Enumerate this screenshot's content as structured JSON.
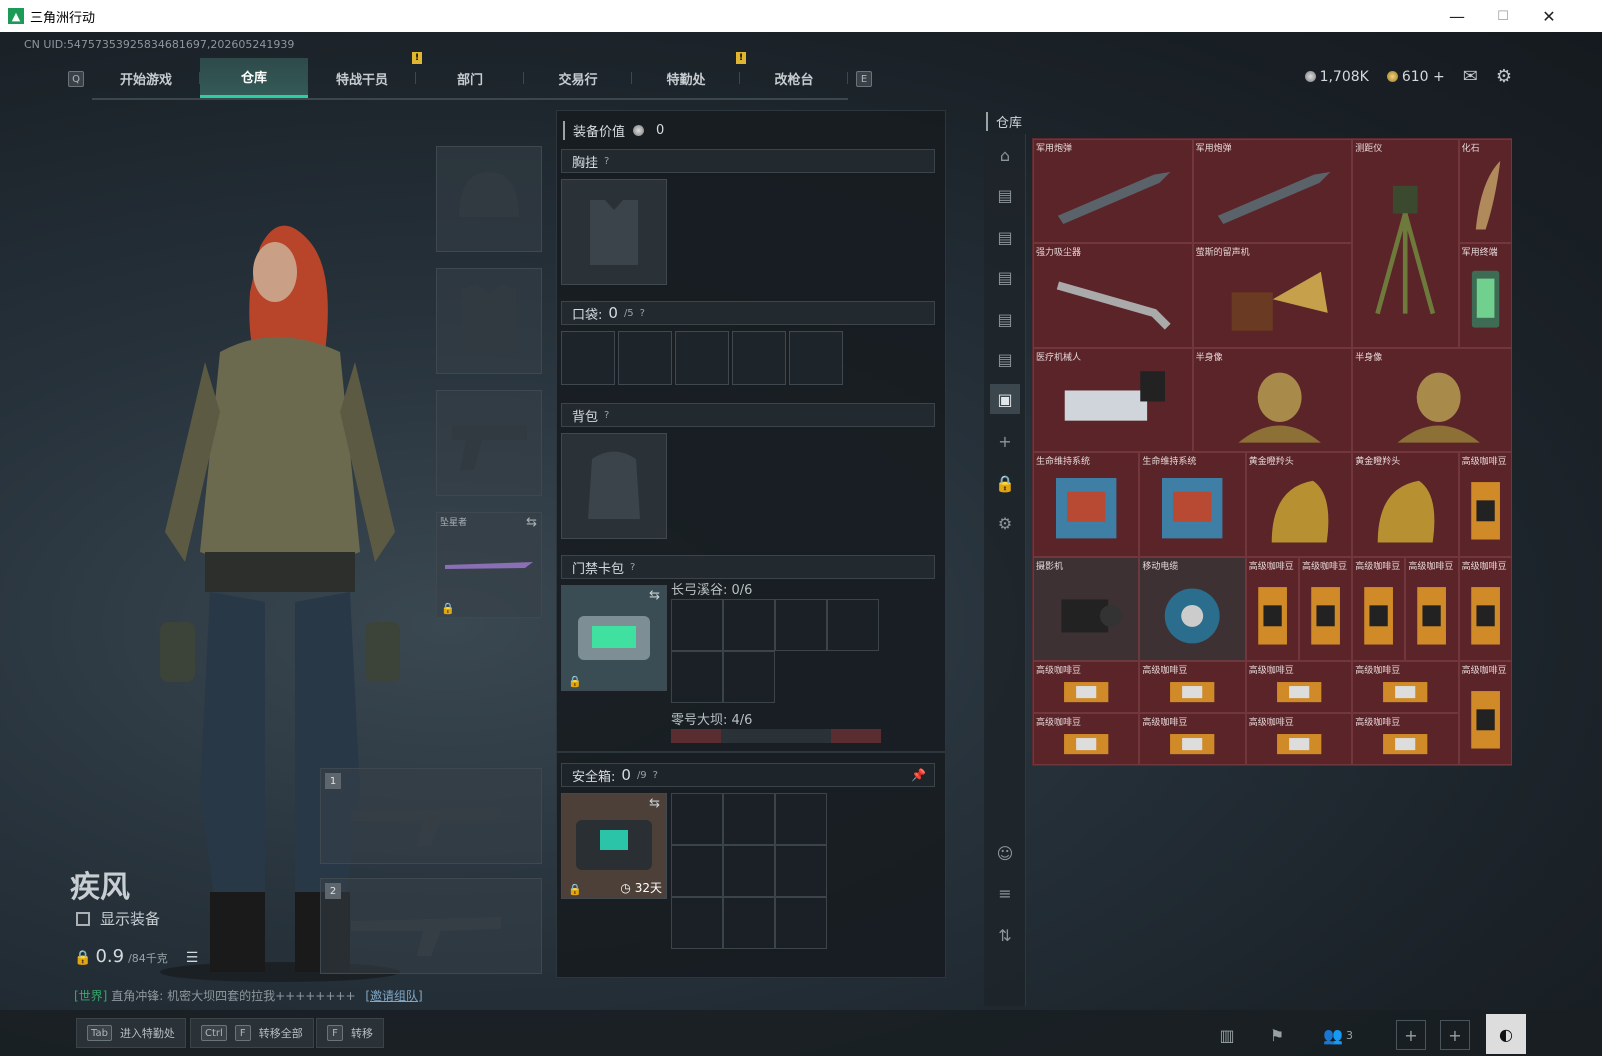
{
  "window": {
    "title": "三角洲行动",
    "minimize": "—",
    "maximize": "☐",
    "close": "✕"
  },
  "uid": "CN UID:5475735392583468169​7,202605241939",
  "nav": {
    "left_key": "Q",
    "right_key": "E",
    "tabs": [
      {
        "label": "开始游戏",
        "active": false,
        "alert": false
      },
      {
        "label": "仓库",
        "active": true,
        "alert": false
      },
      {
        "label": "特战干员",
        "active": false,
        "alert": true
      },
      {
        "label": "部门",
        "active": false,
        "alert": false
      },
      {
        "label": "交易行",
        "active": false,
        "alert": false
      },
      {
        "label": "特勤处",
        "active": false,
        "alert": true
      },
      {
        "label": "改枪台",
        "active": false,
        "alert": false
      }
    ],
    "alert_mark": "!"
  },
  "currency": {
    "silver": "1,708K",
    "gold": "610",
    "plus": "+"
  },
  "character": {
    "name": "疾风",
    "show_equipment": "显示装备",
    "weight_current": "0.9",
    "weight_max": "/84千克",
    "melee_label": "坠星者",
    "slot1": "1",
    "slot2": "2"
  },
  "chat": {
    "channel": "[世界]",
    "user": "直角冲锋:",
    "message": "机密大坝四套的拉我++++++++",
    "invite": "[邀请组队]"
  },
  "equipment_panel": {
    "value_label": "装备价值",
    "value": "0",
    "chest_label": "胸挂",
    "pocket_label": "口袋:",
    "pocket_value": "0",
    "pocket_max": "/5",
    "backpack_label": "背包",
    "keycard_label": "门禁卡包",
    "keycard_grid1": "长弓溪谷: 0/6",
    "keycard_grid2": "零号大坝: 4/6",
    "safebox_label": "安全箱:",
    "safebox_value": "0",
    "safebox_max": "/9",
    "safebox_timer": "32天",
    "help": "?"
  },
  "warehouse": {
    "title": "仓库",
    "items": [
      {
        "name": "军用炮弹",
        "icon": "shell"
      },
      {
        "name": "军用炮弹",
        "icon": "shell"
      },
      {
        "name": "测距仪",
        "icon": "tripod"
      },
      {
        "name": "化石",
        "icon": "fossil"
      },
      {
        "name": "强力吸尘器",
        "icon": "vacuum"
      },
      {
        "name": "萤斯的留声机",
        "icon": "gramophone"
      },
      {
        "name": "军用终端",
        "icon": "terminal"
      },
      {
        "name": "医疗机械人",
        "icon": "robot"
      },
      {
        "name": "半身像",
        "icon": "bust"
      },
      {
        "name": "半身像",
        "icon": "bust"
      },
      {
        "name": "生命维持系统",
        "icon": "lifesupport"
      },
      {
        "name": "生命维持系统",
        "icon": "lifesupport"
      },
      {
        "name": "黄金瞪羚头",
        "icon": "horse"
      },
      {
        "name": "黄金瞪羚头",
        "icon": "horse"
      },
      {
        "name": "高级咖啡豆",
        "icon": "coffee"
      },
      {
        "name": "摄影机",
        "icon": "camera"
      },
      {
        "name": "移动电缆",
        "icon": "cable"
      },
      {
        "name": "高级咖啡豆",
        "icon": "coffee"
      },
      {
        "name": "高级咖啡豆",
        "icon": "coffee"
      },
      {
        "name": "高级咖啡豆",
        "icon": "coffee"
      },
      {
        "name": "高级咖啡豆",
        "icon": "coffee"
      },
      {
        "name": "高级咖啡豆",
        "icon": "coffee"
      },
      {
        "name": "高级咖啡豆",
        "icon": "beans"
      },
      {
        "name": "高级咖啡豆",
        "icon": "beans"
      },
      {
        "name": "高级咖啡豆",
        "icon": "beans"
      },
      {
        "name": "高级咖啡豆",
        "icon": "beans"
      },
      {
        "name": "高级咖啡豆",
        "icon": "coffee"
      },
      {
        "name": "高级咖啡豆",
        "icon": "beans"
      },
      {
        "name": "高级咖啡豆",
        "icon": "beans"
      },
      {
        "name": "高级咖啡豆",
        "icon": "beans"
      },
      {
        "name": "高级咖啡豆",
        "icon": "beans"
      }
    ]
  },
  "bottom": {
    "b1_key": "Tab",
    "b1_label": "进入特勤处",
    "b2_key1": "Ctrl",
    "b2_key2": "F",
    "b2_label": "转移全部",
    "b3_key": "F",
    "b3_label": "转移",
    "squad_count": "3",
    "add": "+"
  },
  "colors": {
    "accent": "#2cd0a0",
    "item_bg": "#5a2429",
    "alert": "#e0b630"
  }
}
